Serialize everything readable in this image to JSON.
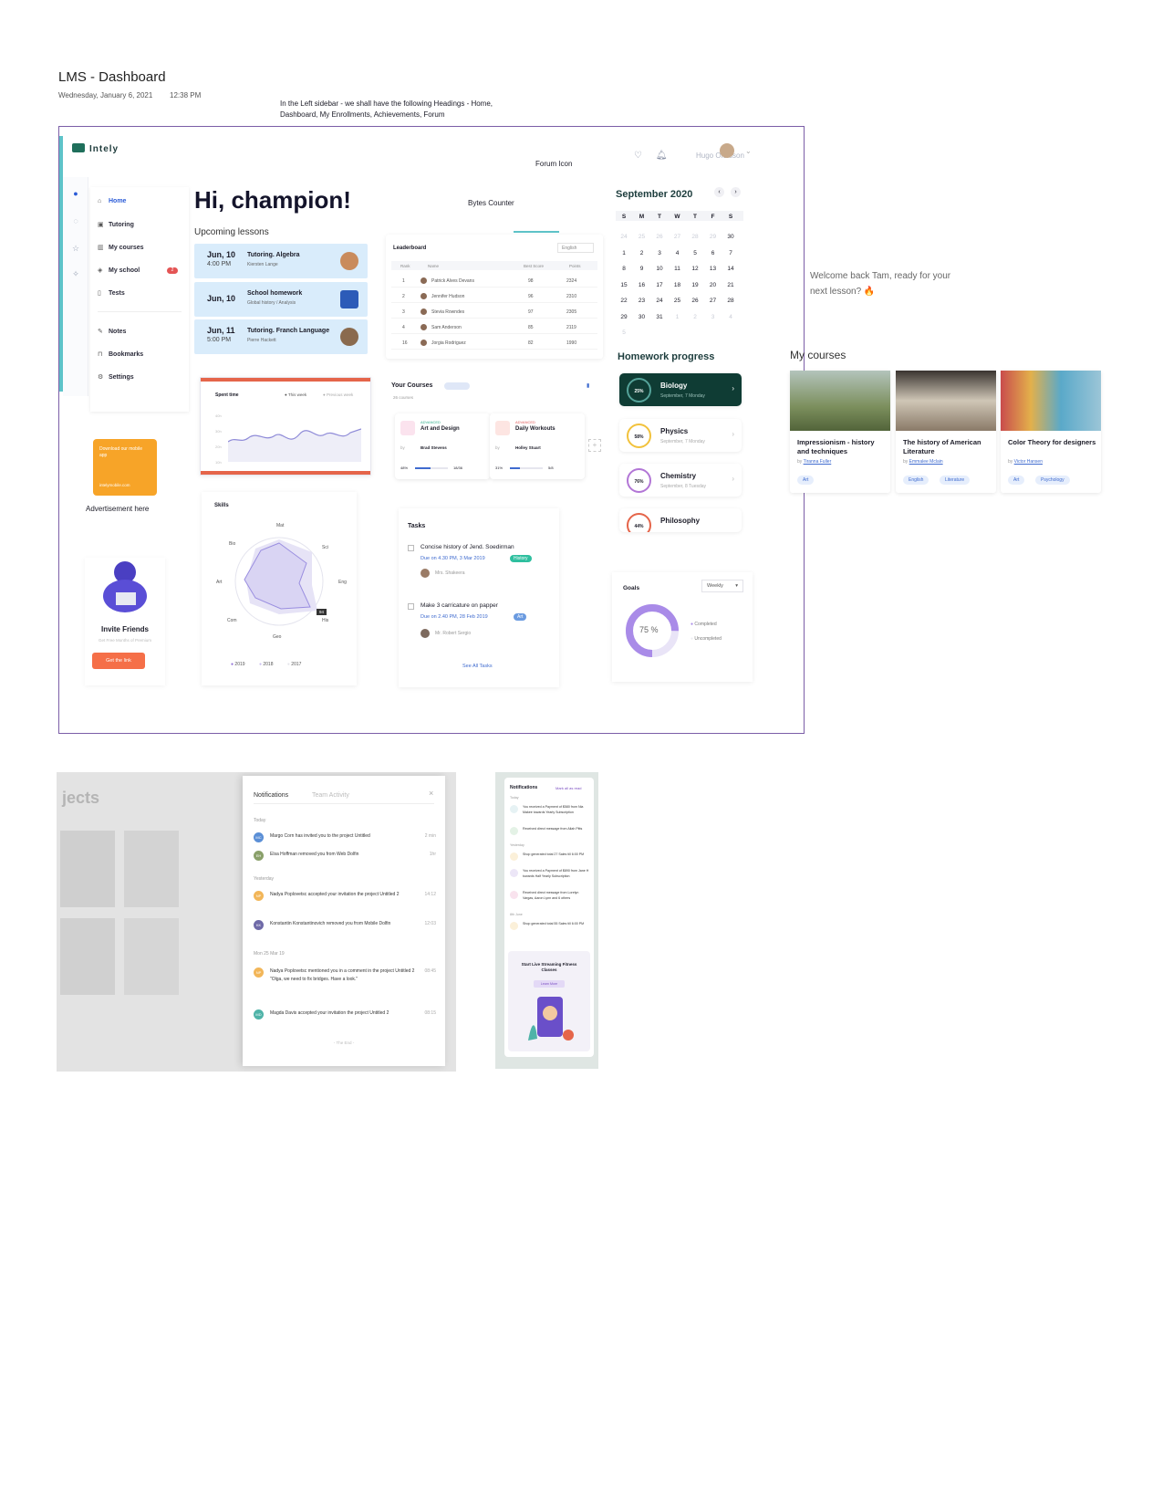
{
  "page": {
    "title": "LMS - Dashboard",
    "date": "Wednesday, January 6, 2021",
    "time": "12:38 PM",
    "note": "In the Left sidebar - we shall have the following Headings - Home, Dashboard, My Enrollments, Achievements, Forum",
    "forum_note": "Forum Icon",
    "bytes_note": "Bytes Counter",
    "ad_note": "Advertisement here"
  },
  "app": {
    "logo": "Intely",
    "user": "Hugo Olofsson",
    "greeting": "Hi, champion!"
  },
  "menu": {
    "items": [
      {
        "label": "Home",
        "icon": "home-icon"
      },
      {
        "label": "Tutoring",
        "icon": "briefcase-icon"
      },
      {
        "label": "My courses",
        "icon": "book-icon"
      },
      {
        "label": "My school",
        "icon": "graduation-icon",
        "badge": "2"
      },
      {
        "label": "Tests",
        "icon": "file-icon"
      },
      {
        "label": "Notes",
        "icon": "pencil-icon"
      },
      {
        "label": "Bookmarks",
        "icon": "bookmark-icon"
      },
      {
        "label": "Settings",
        "icon": "gear-icon"
      }
    ]
  },
  "upcoming": {
    "heading": "Upcoming lessons",
    "lessons": [
      {
        "date": "Jun, 10",
        "time": "4:00 PM",
        "title": "Tutoring. Algebra",
        "sub": "Kiersten Lange"
      },
      {
        "date": "Jun, 10",
        "time": "",
        "title": "School homework",
        "sub": "Global history / Analysis"
      },
      {
        "date": "Jun, 11",
        "time": "5:00 PM",
        "title": "Tutoring. Franch Language",
        "sub": "Pierre Hackett"
      }
    ]
  },
  "leaderboard": {
    "title": "Leaderboard",
    "lang": "English",
    "cols": [
      "Rank",
      "Name",
      "Best Score",
      "Points"
    ],
    "rows": [
      {
        "rank": "1",
        "name": "Patrick Alves Devans",
        "score": "98",
        "pts": "2324"
      },
      {
        "rank": "2",
        "name": "Jennifer Hudson",
        "score": "96",
        "pts": "2310"
      },
      {
        "rank": "3",
        "name": "Stevia Rowndes",
        "score": "97",
        "pts": "2305"
      },
      {
        "rank": "4",
        "name": "Sam Anderson",
        "score": "85",
        "pts": "2119"
      },
      {
        "rank": "16",
        "name": "Jorgia Rodriguez",
        "score": "82",
        "pts": "1990"
      }
    ]
  },
  "spent": {
    "title": "Spent time",
    "legend1": "This week",
    "legend2": "Previous week",
    "yticks": [
      "40h",
      "30h",
      "20h",
      "10h"
    ]
  },
  "skills": {
    "title": "Skills",
    "axes": [
      "Mat",
      "Sci",
      "Eng",
      "His",
      "Geo",
      "Com",
      "Art",
      "Bio"
    ],
    "value": "94",
    "years": [
      "2019",
      "2018",
      "2017"
    ]
  },
  "courses": {
    "title": "Your Courses",
    "count": "26 courses",
    "cards": [
      {
        "level": "ADVANCED",
        "name": "Art and Design",
        "by": "by",
        "author": "Brad Stevens",
        "pct": "48%",
        "count": "18/36"
      },
      {
        "level": "ADVANCED",
        "name": "Daily Workouts",
        "by": "by",
        "author": "Holley Stuart",
        "pct": "31%",
        "count": "5/8"
      }
    ]
  },
  "tasks": {
    "title": "Tasks",
    "items": [
      {
        "name": "Concise history of Jend. Soedirman",
        "due": "Due on 4.30 PM, 3 Mar 2019",
        "tag": "History",
        "person": "Mrs. Shakeera"
      },
      {
        "name": "Make 3 carricature on papper",
        "due": "Due on 2.40 PM, 28 Feb 2019",
        "tag": "Art",
        "person": "Mr. Robert Sergio"
      }
    ],
    "link": "See All Tasks"
  },
  "calendar": {
    "month": "September 2020",
    "days": [
      "S",
      "M",
      "T",
      "W",
      "T",
      "F",
      "S"
    ],
    "cells": [
      "24",
      "25",
      "26",
      "27",
      "28",
      "29",
      "30",
      "1",
      "2",
      "3",
      "4",
      "5",
      "6",
      "7",
      "8",
      "9",
      "10",
      "11",
      "12",
      "13",
      "14",
      "15",
      "16",
      "17",
      "18",
      "19",
      "20",
      "21",
      "22",
      "23",
      "24",
      "25",
      "26",
      "27",
      "28",
      "29",
      "30",
      "31",
      "1",
      "2",
      "3",
      "4",
      "5"
    ],
    "selected": "11"
  },
  "homework": {
    "title": "Homework progress",
    "items": [
      {
        "name": "Biology",
        "date": "September, 7 Monday",
        "pct": "25%"
      },
      {
        "name": "Physics",
        "date": "September, 7 Monday",
        "pct": "58%"
      },
      {
        "name": "Chemistry",
        "date": "September, 8 Tuesday",
        "pct": "76%"
      },
      {
        "name": "Philosophy",
        "date": "",
        "pct": "44%"
      }
    ]
  },
  "goals": {
    "title": "Goals",
    "period": "Weekly",
    "pct": "75 %",
    "completed": "Completed",
    "uncompleted": "Uncompleted",
    "fraction": 0.75
  },
  "ad": {
    "text1": "Download our mobile app",
    "text2": "intelymobile.com"
  },
  "invite": {
    "title": "Invite Friends",
    "sub": "Get Free Months of Premium",
    "button": "Get the link"
  },
  "welcome": "Welcome back Tam, ready for your next lesson? 🔥",
  "mycourses": {
    "title": "My courses",
    "items": [
      {
        "title": "Impressionism - history and techniques",
        "by": "by",
        "author": "Tiranna Fuller",
        "tags": [
          "Art"
        ]
      },
      {
        "title": "The history of American Literature",
        "by": "by",
        "author": "Emmalee Mclain",
        "tags": [
          "English",
          "Literature"
        ]
      },
      {
        "title": "Color Theory for designers",
        "by": "by",
        "author": "Victor Hansen",
        "tags": [
          "Art",
          "Psychology"
        ]
      }
    ]
  },
  "notifA": {
    "tab1": "Notifications",
    "tab2": "Team Activity",
    "bg": "jects",
    "sections": [
      "Today",
      "Yesterday",
      "Mon 25 Mar 19"
    ],
    "items": [
      {
        "ini": "MC",
        "text": "Margo Corn has invited you to the project Untitled",
        "time": "2 min"
      },
      {
        "ini": "EH",
        "text": "Elsa Hoffman removed you from Web Dolfin",
        "time": "1hr"
      },
      {
        "ini": "NP",
        "text": "Nadya Poplovetsc accepted your invitation the project Untitled 2",
        "time": "14:12"
      },
      {
        "ini": "KK",
        "text": "Konstantin Konstantinovich removed you from Mobile Dolfin",
        "time": "12:03"
      },
      {
        "ini": "NP",
        "text": "Nadya Poplovetsc mentioned you in a comment in the project Untitled 2 \"Olga, we need to fix bridges. Have a look.\"",
        "time": "08:45"
      },
      {
        "ini": "MD",
        "text": "Magda Davis accepted your invitation the project Untitled 2",
        "time": "08:15"
      }
    ],
    "end": "- The End -"
  },
  "notifB": {
    "title": "Notifications",
    "mark": "Mark all as read",
    "sections": [
      "Today",
      "Yesterday",
      "8th June"
    ],
    "items": [
      "You received a Payment of $580 from Nia Makee towards Yearly Subscription",
      "Received direct message from Aliah Pitts",
      "Shop generated total 27 Sales till 6:00 PM",
      "You received a Payment of $890 from Jane H towards Half Yearly Subscription",
      "Received direct message from Lorelyn Vargas, Aaron Lynn and 6 others",
      "Shop generated total 55 Sales till 6:00 PM"
    ],
    "promo": "Start Live Streaming Fitness Classes",
    "promo_btn": "Learn More"
  }
}
